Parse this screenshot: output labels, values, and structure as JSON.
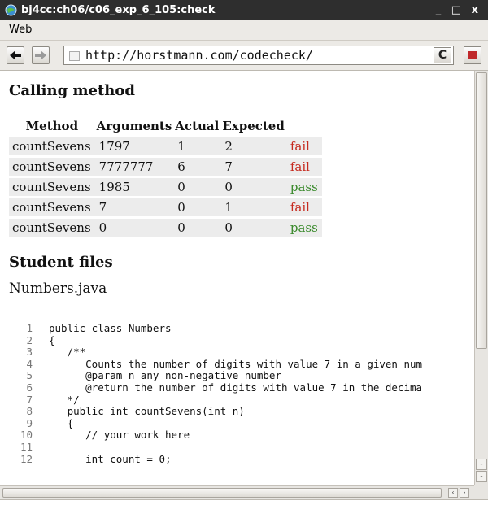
{
  "window": {
    "title": "bj4cc:ch06/c06_exp_6_105:check",
    "controls": "_ □ x"
  },
  "menu": {
    "items": [
      "Web"
    ]
  },
  "toolbar": {
    "url": "http://horstmann.com/codecheck/",
    "reload_label": "C"
  },
  "calling": {
    "heading": "Calling method",
    "headers": [
      "Method",
      "Arguments",
      "Actual",
      "Expected"
    ],
    "rows": [
      {
        "method": "countSevens",
        "args": "1797",
        "actual": "1",
        "expected": "2",
        "result": "fail"
      },
      {
        "method": "countSevens",
        "args": "7777777",
        "actual": "6",
        "expected": "7",
        "result": "fail"
      },
      {
        "method": "countSevens",
        "args": "1985",
        "actual": "0",
        "expected": "0",
        "result": "pass"
      },
      {
        "method": "countSevens",
        "args": "7",
        "actual": "0",
        "expected": "1",
        "result": "fail"
      },
      {
        "method": "countSevens",
        "args": "0",
        "actual": "0",
        "expected": "0",
        "result": "pass"
      }
    ]
  },
  "student": {
    "heading": "Student files",
    "filename": "Numbers.java"
  },
  "code": [
    {
      "n": "1",
      "text": "public class Numbers"
    },
    {
      "n": "2",
      "text": "{"
    },
    {
      "n": "3",
      "text": "   /**"
    },
    {
      "n": "4",
      "text": "      Counts the number of digits with value 7 in a given num"
    },
    {
      "n": "5",
      "text": "      @param n any non-negative number"
    },
    {
      "n": "6",
      "text": "      @return the number of digits with value 7 in the decima"
    },
    {
      "n": "7",
      "text": "   */"
    },
    {
      "n": "8",
      "text": "   public int countSevens(int n)"
    },
    {
      "n": "9",
      "text": "   {"
    },
    {
      "n": "10",
      "text": "      // your work here"
    },
    {
      "n": "11",
      "text": ""
    },
    {
      "n": "12",
      "text": "      int count = 0;"
    }
  ],
  "colors": {
    "fail": "#c62a1f",
    "pass": "#3a8a2c",
    "titlebar": "#2e2e2e"
  },
  "icons": [
    "app-globe-icon",
    "back-arrow-icon",
    "forward-arrow-icon",
    "favicon-icon",
    "reload-icon",
    "stop-icon"
  ]
}
